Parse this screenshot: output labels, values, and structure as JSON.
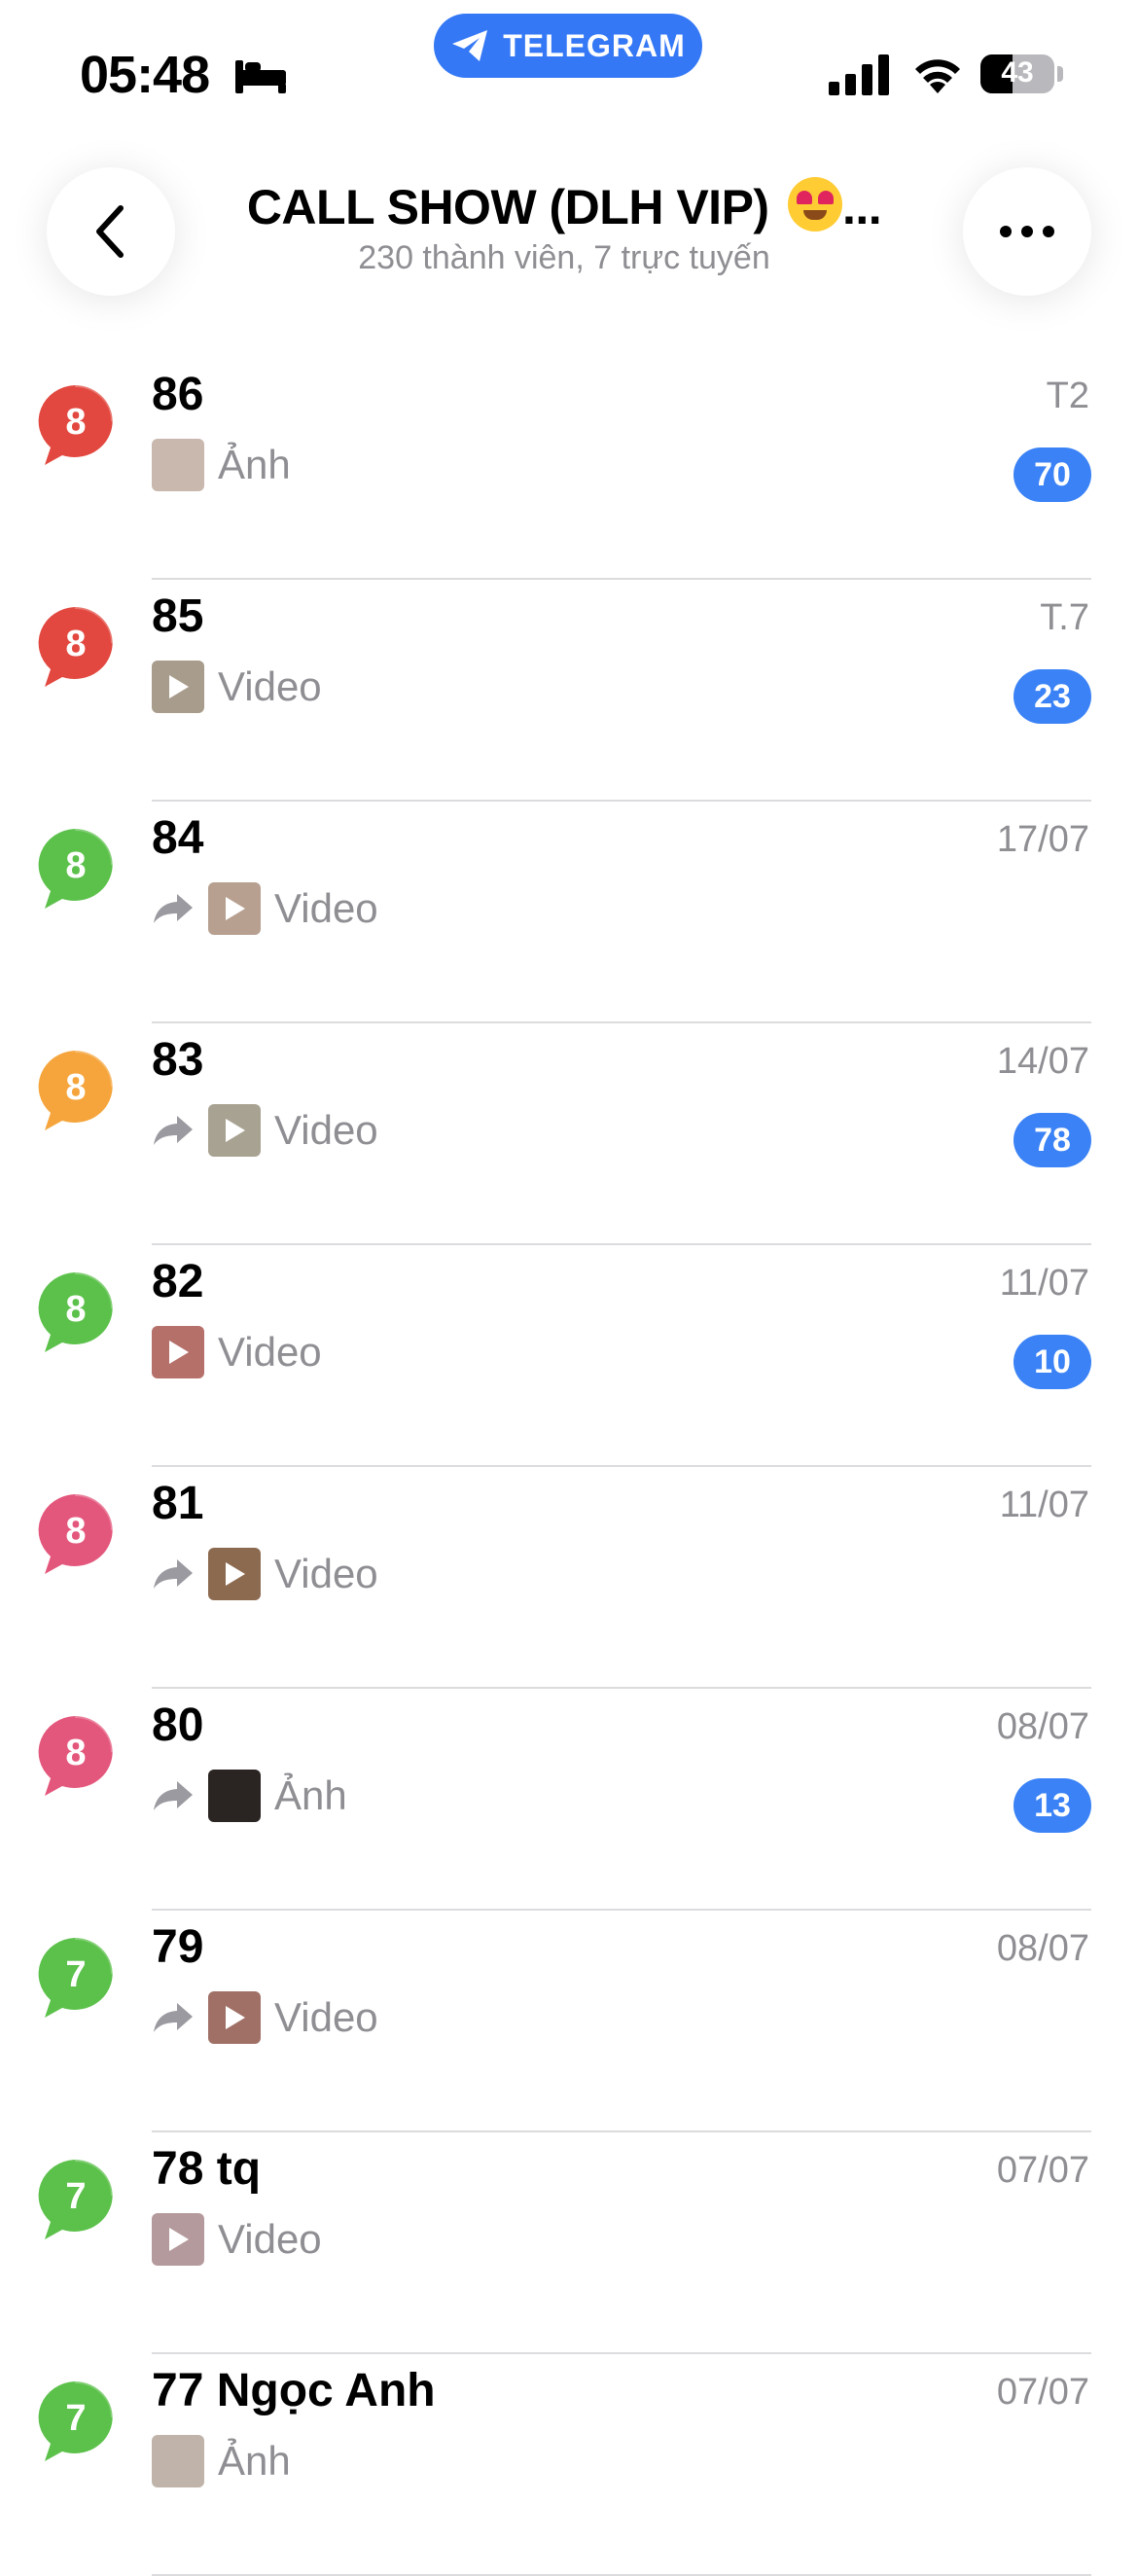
{
  "status_bar": {
    "time": "05:48",
    "battery": "43",
    "battery_level": 0.43,
    "app_pill": "TELEGRAM"
  },
  "header": {
    "title": "CALL SHOW (DLH VIP)",
    "title_suffix": "...",
    "subtitle": "230 thành viên, 7 trực tuyến",
    "back_icon": "chevron-left-icon",
    "more_icon": "ellipsis-icon"
  },
  "colors": {
    "unread_badge": "#3a82f6",
    "avatar_red": "#e2483f",
    "avatar_green": "#5cc14b",
    "avatar_orange": "#f5a53c",
    "avatar_pink": "#e4577c"
  },
  "chats": [
    {
      "title": "86",
      "date": "T2",
      "forwarded": false,
      "media": "Ảnh",
      "is_video": false,
      "unread": "70",
      "avatar_number": "8",
      "avatar_color": "#e2483f",
      "thumb_color": "#c8b8ae"
    },
    {
      "title": "85",
      "date": "T.7",
      "forwarded": false,
      "media": "Video",
      "is_video": true,
      "unread": "23",
      "avatar_number": "8",
      "avatar_color": "#e2483f",
      "thumb_color": "#a89c8c"
    },
    {
      "title": "84",
      "date": "17/07",
      "forwarded": true,
      "media": "Video",
      "is_video": true,
      "unread": "",
      "avatar_number": "8",
      "avatar_color": "#5cc14b",
      "thumb_color": "#b7a090"
    },
    {
      "title": "83",
      "date": "14/07",
      "forwarded": true,
      "media": "Video",
      "is_video": true,
      "unread": "78",
      "avatar_number": "8",
      "avatar_color": "#f5a53c",
      "thumb_color": "#a8a292"
    },
    {
      "title": "82",
      "date": "11/07",
      "forwarded": false,
      "media": "Video",
      "is_video": true,
      "unread": "10",
      "avatar_number": "8",
      "avatar_color": "#5cc14b",
      "thumb_color": "#b5706a"
    },
    {
      "title": "81",
      "date": "11/07",
      "forwarded": true,
      "media": "Video",
      "is_video": true,
      "unread": "",
      "avatar_number": "8",
      "avatar_color": "#e4577c",
      "thumb_color": "#8c6a50"
    },
    {
      "title": "80",
      "date": "08/07",
      "forwarded": true,
      "media": "Ảnh",
      "is_video": false,
      "unread": "13",
      "avatar_number": "8",
      "avatar_color": "#e4577c",
      "thumb_color": "#2a2422"
    },
    {
      "title": "79",
      "date": "08/07",
      "forwarded": true,
      "media": "Video",
      "is_video": true,
      "unread": "",
      "avatar_number": "7",
      "avatar_color": "#5cc14b",
      "thumb_color": "#a07066"
    },
    {
      "title": "78 tq",
      "date": "07/07",
      "forwarded": false,
      "media": "Video",
      "is_video": true,
      "unread": "",
      "avatar_number": "7",
      "avatar_color": "#5cc14b",
      "thumb_color": "#b49a9c"
    },
    {
      "title": "77 Ngọc Anh",
      "date": "07/07",
      "forwarded": false,
      "media": "Ảnh",
      "is_video": false,
      "unread": "",
      "avatar_number": "7",
      "avatar_color": "#5cc14b",
      "thumb_color": "#c0b4aa"
    }
  ]
}
